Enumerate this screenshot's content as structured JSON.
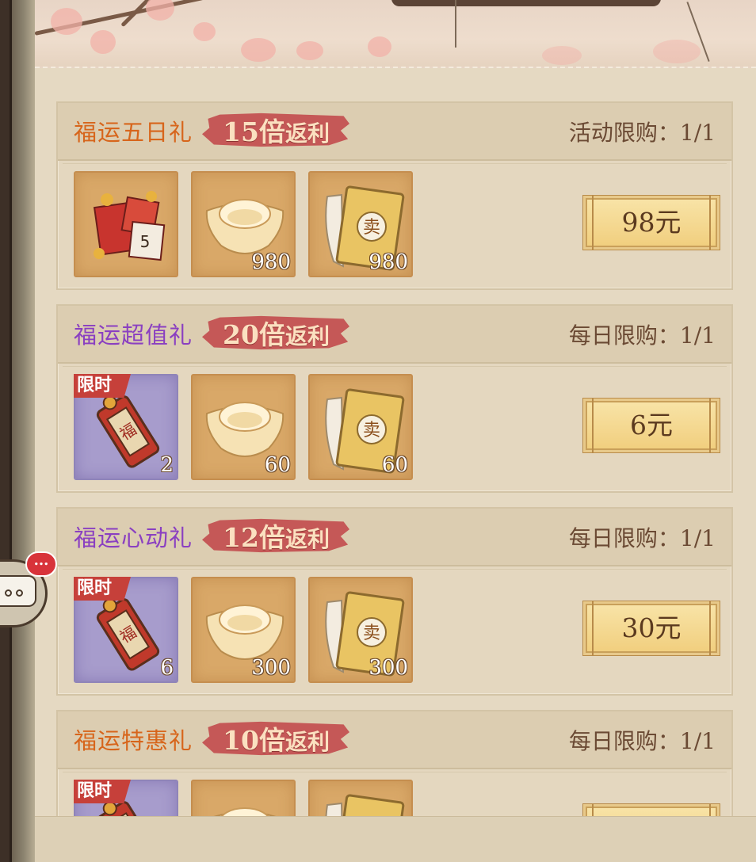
{
  "offers": [
    {
      "title": "福运五日礼",
      "title_color": "#d7651b",
      "multiplier": "15倍",
      "multiplier_suffix": "返利",
      "limit": "活动限购：1/1",
      "price": "98元",
      "items": [
        {
          "icon": "gift-pile-icon",
          "count": "",
          "tag": "",
          "bg": "gold"
        },
        {
          "icon": "gold-ingot-icon",
          "count": "980",
          "tag": "",
          "bg": "gold"
        },
        {
          "icon": "gold-book-icon",
          "count": "980",
          "tag": "",
          "bg": "gold"
        }
      ]
    },
    {
      "title": "福运超值礼",
      "title_color": "#8a3fc1",
      "multiplier": "20倍",
      "multiplier_suffix": "返利",
      "limit": "每日限购：1/1",
      "price": "6元",
      "items": [
        {
          "icon": "fortune-token-icon",
          "count": "2",
          "tag": "限时",
          "bg": "purple"
        },
        {
          "icon": "gold-ingot-icon",
          "count": "60",
          "tag": "",
          "bg": "gold"
        },
        {
          "icon": "gold-book-icon",
          "count": "60",
          "tag": "",
          "bg": "gold"
        }
      ]
    },
    {
      "title": "福运心动礼",
      "title_color": "#8a3fc1",
      "multiplier": "12倍",
      "multiplier_suffix": "返利",
      "limit": "每日限购：1/1",
      "price": "30元",
      "items": [
        {
          "icon": "fortune-token-icon",
          "count": "6",
          "tag": "限时",
          "bg": "purple"
        },
        {
          "icon": "gold-ingot-icon",
          "count": "300",
          "tag": "",
          "bg": "gold"
        },
        {
          "icon": "gold-book-icon",
          "count": "300",
          "tag": "",
          "bg": "gold"
        }
      ]
    },
    {
      "title": "福运特惠礼",
      "title_color": "#d7651b",
      "multiplier": "10倍",
      "multiplier_suffix": "返利",
      "limit": "每日限购：1/1",
      "price": "",
      "items": [
        {
          "icon": "fortune-token-icon",
          "count": "",
          "tag": "限时",
          "bg": "purple"
        },
        {
          "icon": "gold-ingot-icon",
          "count": "",
          "tag": "",
          "bg": "gold"
        },
        {
          "icon": "gold-book-icon",
          "count": "",
          "tag": "",
          "bg": "gold"
        }
      ]
    }
  ],
  "chat": {
    "badge": "..."
  }
}
